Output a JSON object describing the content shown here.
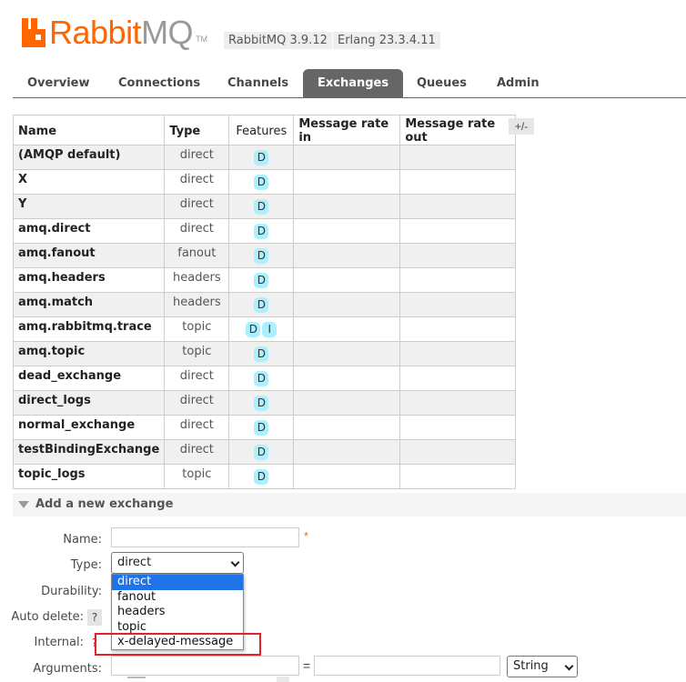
{
  "header": {
    "logo_text_a": "Rabbit",
    "logo_text_b": "MQ",
    "logo_tm": "TM",
    "version": "RabbitMQ 3.9.12",
    "erlang": "Erlang 23.3.4.11"
  },
  "tabs": [
    {
      "label": "Overview",
      "active": false
    },
    {
      "label": "Connections",
      "active": false
    },
    {
      "label": "Channels",
      "active": false
    },
    {
      "label": "Exchanges",
      "active": true
    },
    {
      "label": "Queues",
      "active": false
    },
    {
      "label": "Admin",
      "active": false
    }
  ],
  "table": {
    "headers": {
      "name": "Name",
      "type": "Type",
      "features": "Features",
      "rate_in": "Message rate in",
      "rate_out": "Message rate out"
    },
    "toggle": "+/-",
    "rows": [
      {
        "name": "(AMQP default)",
        "type": "direct",
        "features": [
          "D"
        ]
      },
      {
        "name": "X",
        "type": "direct",
        "features": [
          "D"
        ]
      },
      {
        "name": "Y",
        "type": "direct",
        "features": [
          "D"
        ]
      },
      {
        "name": "amq.direct",
        "type": "direct",
        "features": [
          "D"
        ]
      },
      {
        "name": "amq.fanout",
        "type": "fanout",
        "features": [
          "D"
        ]
      },
      {
        "name": "amq.headers",
        "type": "headers",
        "features": [
          "D"
        ]
      },
      {
        "name": "amq.match",
        "type": "headers",
        "features": [
          "D"
        ]
      },
      {
        "name": "amq.rabbitmq.trace",
        "type": "topic",
        "features": [
          "D",
          "I"
        ]
      },
      {
        "name": "amq.topic",
        "type": "topic",
        "features": [
          "D"
        ]
      },
      {
        "name": "dead_exchange",
        "type": "direct",
        "features": [
          "D"
        ]
      },
      {
        "name": "direct_logs",
        "type": "direct",
        "features": [
          "D"
        ]
      },
      {
        "name": "normal_exchange",
        "type": "direct",
        "features": [
          "D"
        ]
      },
      {
        "name": "testBindingExchange",
        "type": "direct",
        "features": [
          "D"
        ]
      },
      {
        "name": "topic_logs",
        "type": "topic",
        "features": [
          "D"
        ]
      }
    ]
  },
  "add_exchange": {
    "title": "Add a new exchange",
    "labels": {
      "name": "Name:",
      "type": "Type:",
      "durability": "Durability:",
      "auto_delete": "Auto delete:",
      "internal": "Internal:",
      "arguments": "Arguments:"
    },
    "name_value": "",
    "required_star": "*",
    "help": "?",
    "type_selected": "direct",
    "type_options": [
      "direct",
      "fanout",
      "headers",
      "topic",
      "x-delayed-message"
    ],
    "equals": "=",
    "arg_type_selected": "String"
  },
  "colors": {
    "brand": "#ff6600",
    "active_tab": "#666666",
    "badge": "#aaf0ff",
    "dropdown_selected": "#1e73e8",
    "highlight_box": "#e0232b"
  }
}
